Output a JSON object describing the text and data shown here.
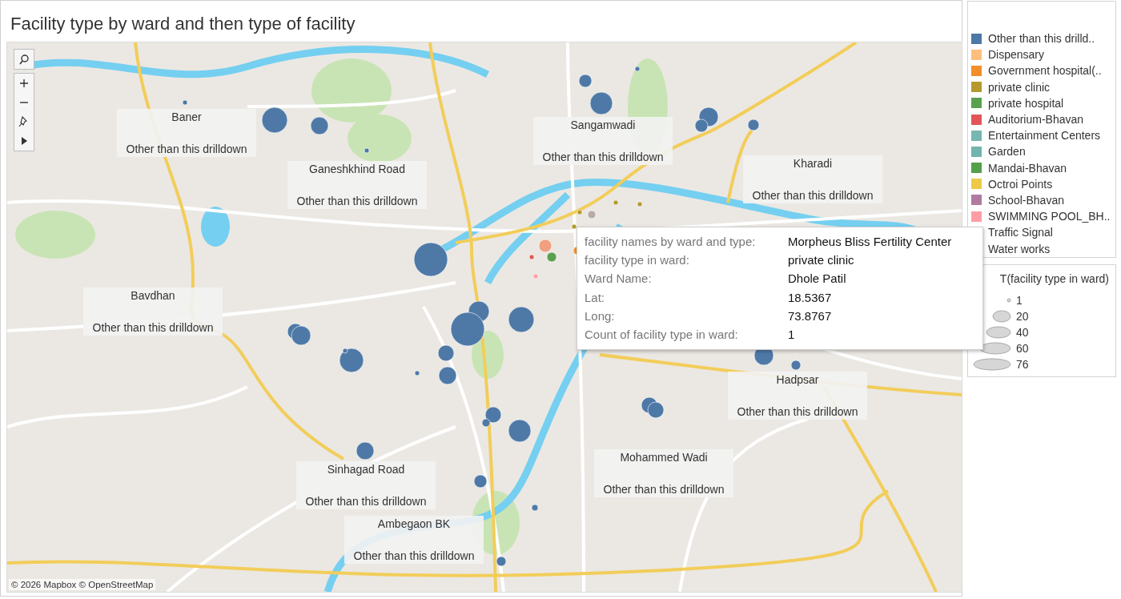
{
  "dashboard": {
    "title": "Facility type by ward and then type of facility"
  },
  "map": {
    "attribution": "© 2026 Mapbox © OpenStreetMap",
    "toolbar": [
      {
        "kind": "search"
      },
      {
        "kind": "zoom-in"
      },
      {
        "kind": "zoom-out"
      },
      {
        "kind": "pin"
      },
      {
        "kind": "expand"
      }
    ],
    "labels": [
      {
        "title": "Baner",
        "subtitle": "Other than this drilldown"
      },
      {
        "title": "Ganeshkhind Road",
        "subtitle": "Other than this drilldown"
      },
      {
        "title": "Sangamwadi",
        "subtitle": "Other than this drilldown"
      },
      {
        "title": "Kharadi",
        "subtitle": "Other than this drilldown"
      },
      {
        "title": "Bavdhan",
        "subtitle": "Other than this drilldown"
      },
      {
        "title": "Hadpsar",
        "subtitle": "Other than this drilldown"
      },
      {
        "title": "Mohammed Wadi",
        "subtitle": "Other than this drilldown"
      },
      {
        "title": "Sinhagad Road",
        "subtitle": "Other than this drilldown"
      },
      {
        "title": "Ambegaon BK",
        "subtitle": "Other than this drilldown"
      }
    ]
  },
  "tooltip": {
    "rows": [
      {
        "label": "facility names by ward and type:",
        "value": "Morpheus Bliss Fertility Center"
      },
      {
        "label": "facility type in ward:",
        "value": "private clinic"
      },
      {
        "label": "Ward Name:",
        "value": "Dhole Patil"
      },
      {
        "label": "Lat:",
        "value": "18.5367"
      },
      {
        "label": "Long:",
        "value": "73.8767"
      },
      {
        "label": "Count of facility type in ward:",
        "value": "1"
      }
    ]
  },
  "color_legend": {
    "items": [
      {
        "label": "Other than this drilld..",
        "color": "#4e79a7"
      },
      {
        "label": "Dispensary",
        "color": "#ffbe7d"
      },
      {
        "label": "Government hospital(..",
        "color": "#f28e2b"
      },
      {
        "label": "private clinic",
        "color": "#b6992d"
      },
      {
        "label": "private hospital",
        "color": "#59a14f"
      },
      {
        "label": "Auditorium-Bhavan",
        "color": "#e15759"
      },
      {
        "label": "Entertainment Centers",
        "color": "#76b7b2"
      },
      {
        "label": "Garden",
        "color": "#72b4ae"
      },
      {
        "label": "Mandai-Bhavan",
        "color": "#53a04a"
      },
      {
        "label": "Octroi Points",
        "color": "#edc948"
      },
      {
        "label": "School-Bhavan",
        "color": "#b07aa1"
      },
      {
        "label": "SWIMMING POOL_BH..",
        "color": "#ff9da7"
      },
      {
        "label": "Traffic Signal"
      },
      {
        "label": "Water works"
      }
    ]
  },
  "size_legend": {
    "title": "T(facility type in ward)",
    "items": [
      {
        "label": "1"
      },
      {
        "label": "20"
      },
      {
        "label": "40"
      },
      {
        "label": "60"
      },
      {
        "label": "76"
      }
    ]
  }
}
